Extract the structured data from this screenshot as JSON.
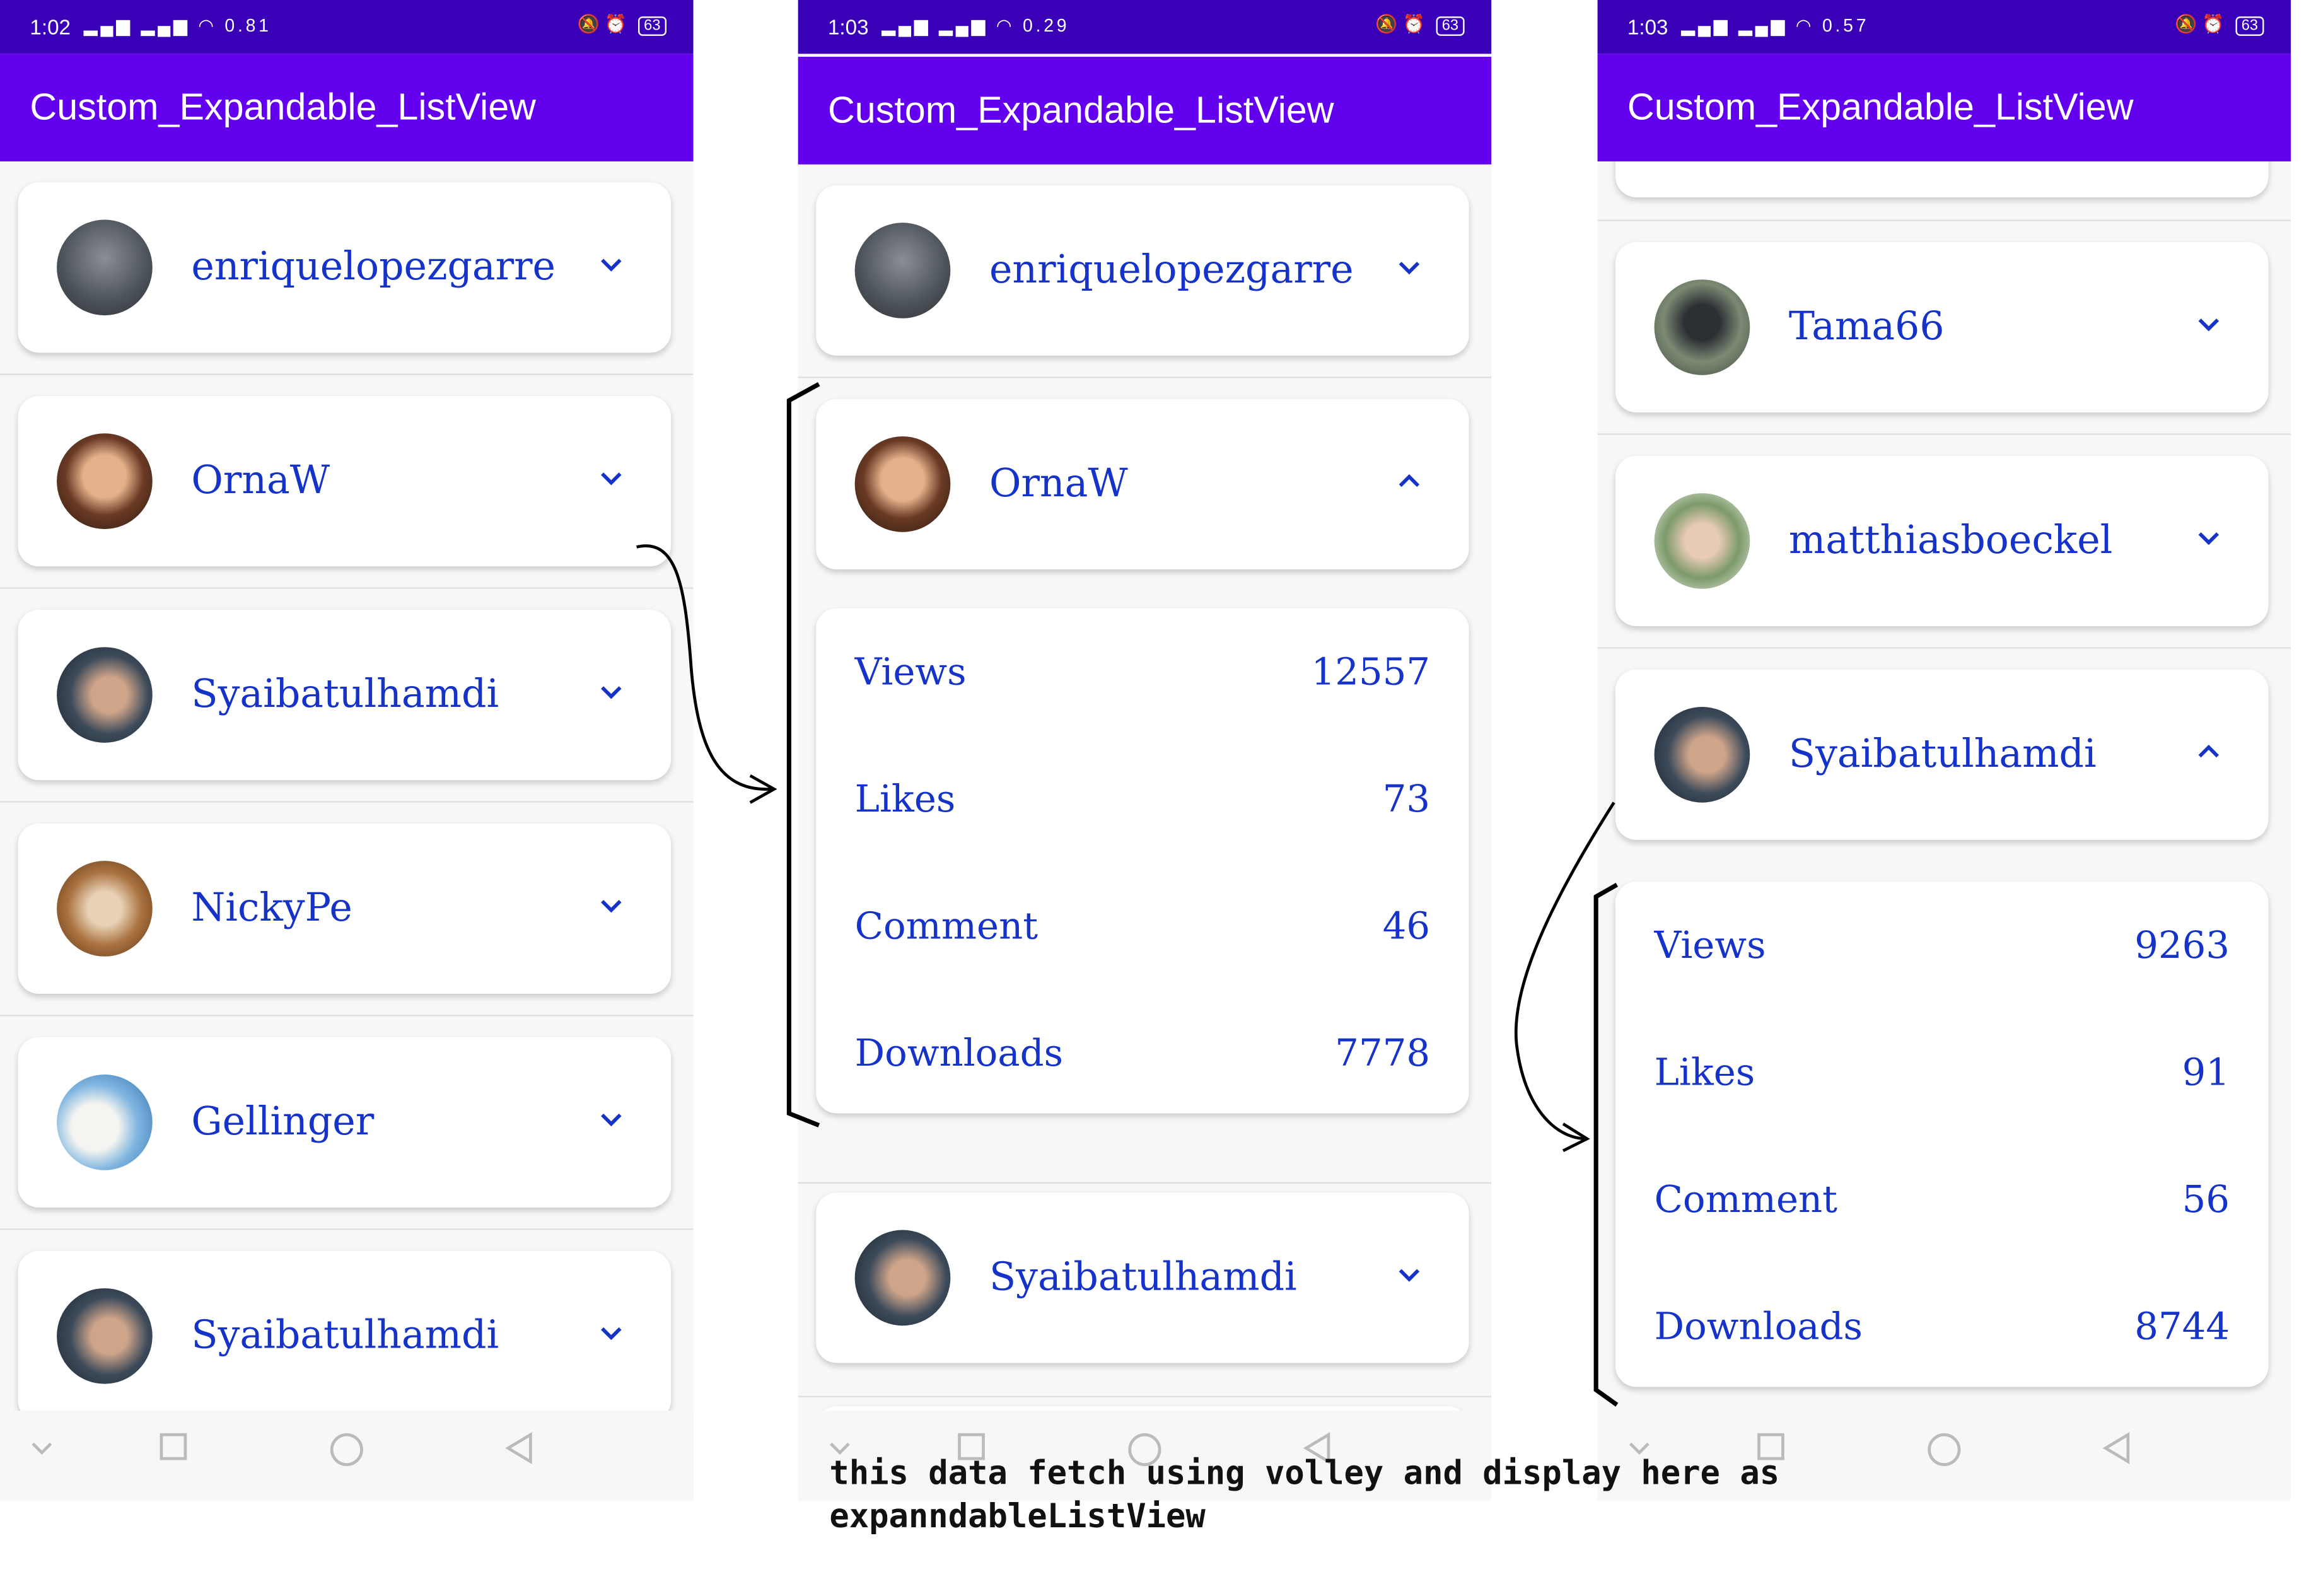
{
  "app_title": "Custom_Expandable_ListView",
  "caption": [
    "this data fetch using volley and display here as",
    "expanndableListView"
  ],
  "colors": {
    "status_bar": "#3a00b8",
    "app_bar": "#6200ee",
    "item_text": "#1533c9"
  },
  "phones": [
    {
      "status": {
        "time": "1:02",
        "speed": "0.81",
        "battery": "63"
      },
      "items": [
        {
          "name": "enriquelopezgarre",
          "expanded": false
        },
        {
          "name": "OrnaW",
          "expanded": false
        },
        {
          "name": "Syaibatulhamdi",
          "expanded": false
        },
        {
          "name": "NickyPe",
          "expanded": false
        },
        {
          "name": "Gellinger",
          "expanded": false
        },
        {
          "name": "Syaibatulhamdi",
          "expanded": false
        }
      ]
    },
    {
      "status": {
        "time": "1:03",
        "speed": "0.29",
        "battery": "63"
      },
      "items": [
        {
          "name": "enriquelopezgarre",
          "expanded": false
        },
        {
          "name": "OrnaW",
          "expanded": true,
          "details": [
            {
              "label": "Views",
              "value": "12557"
            },
            {
              "label": "Likes",
              "value": "73"
            },
            {
              "label": "Comment",
              "value": "46"
            },
            {
              "label": "Downloads",
              "value": "7778"
            }
          ]
        },
        {
          "name": "Syaibatulhamdi",
          "expanded": false
        }
      ]
    },
    {
      "status": {
        "time": "1:03",
        "speed": "0.57",
        "battery": "63"
      },
      "items": [
        {
          "name": "Tama66",
          "expanded": false
        },
        {
          "name": "matthiasboeckel",
          "expanded": false
        },
        {
          "name": "Syaibatulhamdi",
          "expanded": true,
          "details": [
            {
              "label": "Views",
              "value": "9263"
            },
            {
              "label": "Likes",
              "value": "91"
            },
            {
              "label": "Comment",
              "value": "56"
            },
            {
              "label": "Downloads",
              "value": "8744"
            }
          ]
        }
      ]
    }
  ]
}
